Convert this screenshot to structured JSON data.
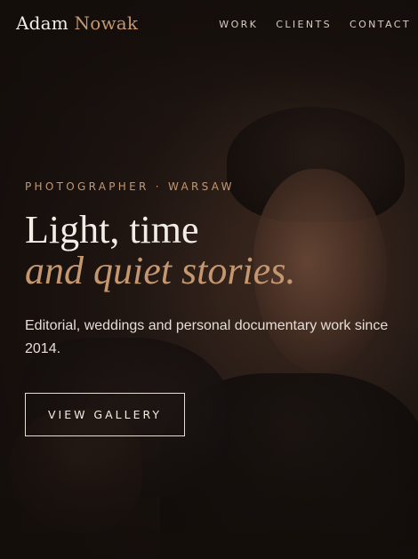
{
  "nav": {
    "brand_first": "Adam",
    "brand_last": "Nowak",
    "links": [
      "WORK",
      "CLIENTS",
      "CONTACT"
    ]
  },
  "hero": {
    "eyebrow": "PHOTOGRAPHER · WARSAW",
    "headline_line1": "Light, time",
    "headline_line2": "and quiet stories.",
    "lede": "Editorial, weddings and personal documentary work since 2014.",
    "cta_label": "VIEW GALLERY",
    "background_image": "photographer-holding-camera"
  },
  "colors": {
    "accent": "#c4976f",
    "text_primary": "#f2ece6",
    "background": "#1a1411"
  }
}
